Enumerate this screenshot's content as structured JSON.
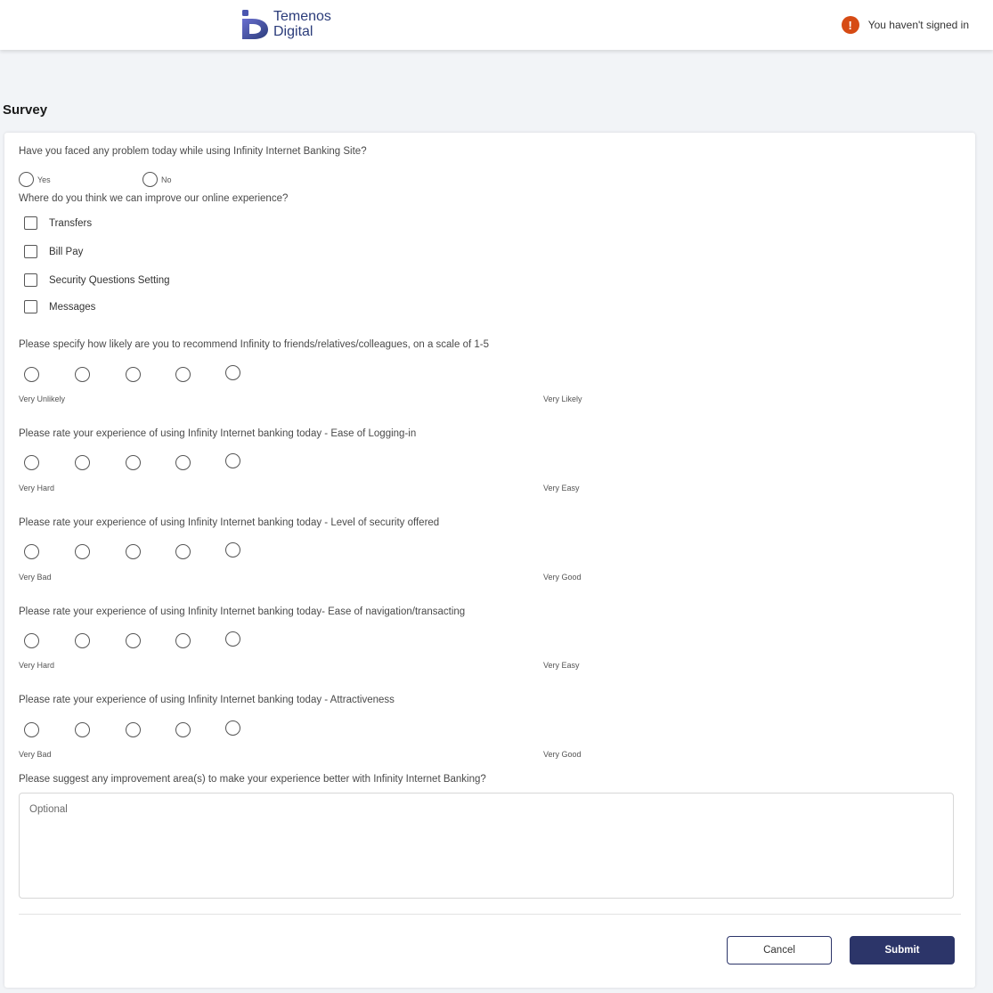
{
  "header": {
    "logo_line1": "Temenos",
    "logo_line2": "Digital",
    "signin_icon": "warning-icon",
    "signin_icon_glyph": "!",
    "signin_text": "You haven't signed in"
  },
  "page": {
    "title": "Survey"
  },
  "survey": {
    "q1": {
      "text": "Have you faced any problem today while using Infinity Internet Banking Site?",
      "options": [
        "Yes",
        "No"
      ]
    },
    "q2": {
      "text": "Where do you think we can improve our online experience?",
      "options": [
        "Transfers",
        "Bill Pay",
        "Security Questions Setting",
        "Messages"
      ]
    },
    "q3": {
      "text": "Please specify how likely are you to recommend Infinity to friends/relatives/colleagues, on a scale of 1-5",
      "low": "Very Unlikely",
      "high": "Very Likely"
    },
    "q4": {
      "text": "Please rate your experience of using Infinity Internet banking today - Ease of Logging-in",
      "low": "Very Hard",
      "high": "Very Easy"
    },
    "q5": {
      "text": "Please rate your experience of using Infinity Internet banking today - Level of security offered",
      "low": "Very Bad",
      "high": "Very Good"
    },
    "q6": {
      "text": "Please rate your experience of using Infinity Internet banking today- Ease of navigation/transacting",
      "low": "Very Hard",
      "high": "Very Easy"
    },
    "q7": {
      "text": "Please rate your experience of using Infinity Internet banking today - Attractiveness",
      "low": "Very Bad",
      "high": "Very Good"
    },
    "q8": {
      "text": "Please suggest any improvement area(s) to make your experience better with Infinity Internet Banking?",
      "placeholder": "Optional"
    }
  },
  "actions": {
    "cancel_label": "Cancel",
    "submit_label": "Submit"
  },
  "colors": {
    "brand_navy": "#2c3569",
    "warning": "#d64b14",
    "logo_blue": "#2b3c7a"
  }
}
